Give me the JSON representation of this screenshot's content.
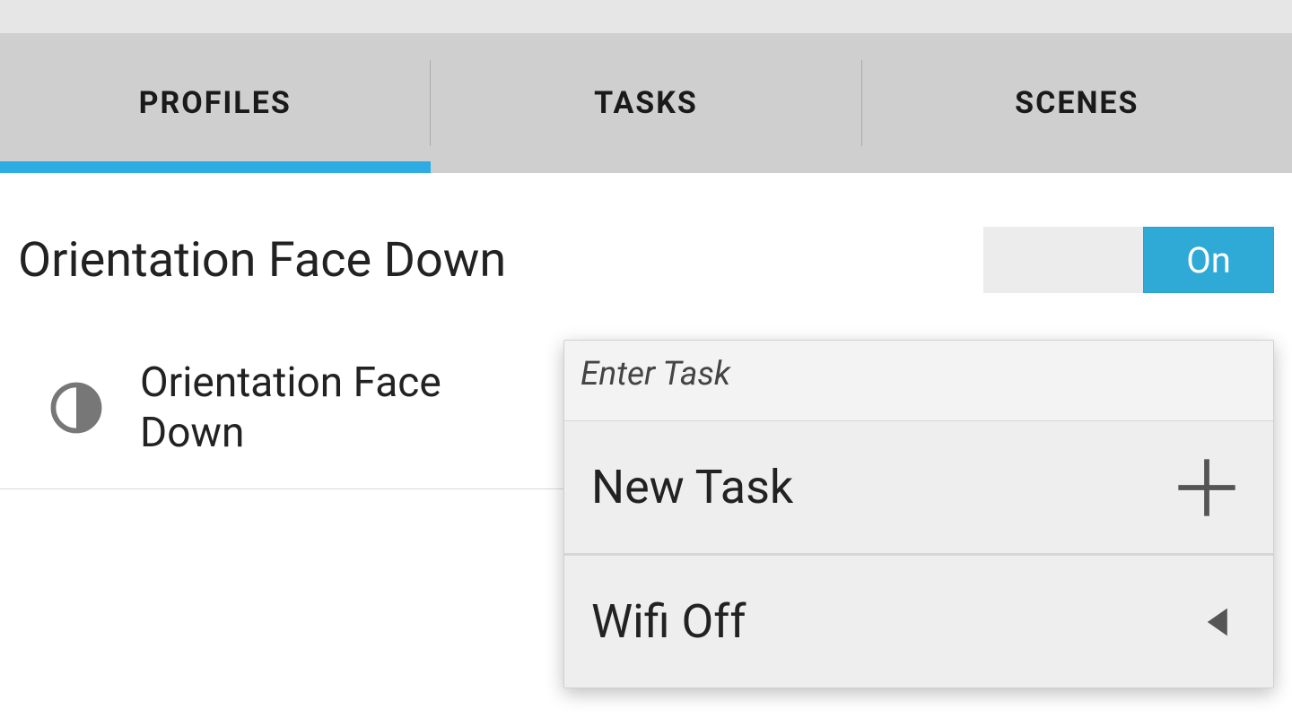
{
  "tabs": {
    "items": [
      "PROFILES",
      "TASKS",
      "SCENES"
    ],
    "active_index": 0
  },
  "profile": {
    "title": "Orientation Face Down",
    "toggle_label_on": "On",
    "toggle_state": "on",
    "context_label": "Orientation Face Down"
  },
  "popup": {
    "header": "Enter Task",
    "items": [
      {
        "label": "New Task",
        "icon": "plus"
      },
      {
        "label": "Wifi Off",
        "icon": "triangle-left"
      }
    ]
  }
}
